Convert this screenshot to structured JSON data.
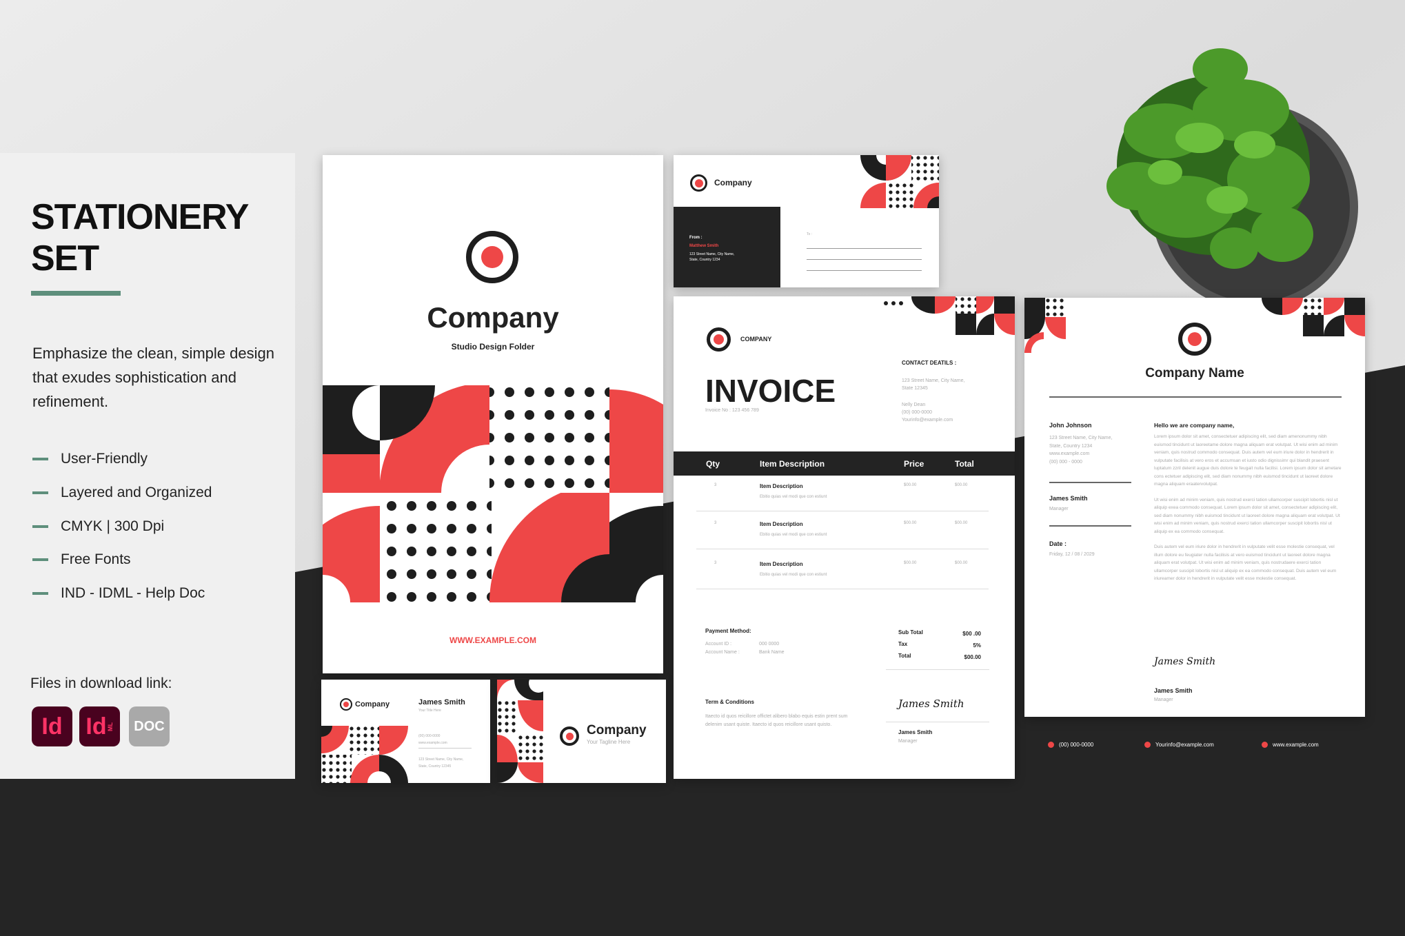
{
  "colors": {
    "accent_red": "#ee4747",
    "dark": "#232323",
    "green": "#5e8f7c",
    "panel": "#f0f0f0"
  },
  "left_panel": {
    "title_line1": "STATIONERY",
    "title_line2": "SET",
    "description": "Emphasize the clean, simple design that exudes sophistication and refinement.",
    "features": [
      "User-Friendly",
      "Layered and Organized",
      "CMYK | 300 Dpi",
      "Free Fonts",
      "IND - IDML - Help Doc"
    ],
    "files_label": "Files in download link:",
    "file_icons": [
      {
        "icon": "indesign-icon",
        "label": "Id"
      },
      {
        "icon": "idml-icon",
        "label": "Id",
        "sub": "ML"
      },
      {
        "icon": "doc-icon",
        "label": "DOC"
      }
    ]
  },
  "folder": {
    "company": "Company",
    "subtitle": "Studio Design Folder",
    "website": "WWW.EXAMPLE.COM"
  },
  "envelope": {
    "company": "Company",
    "from_label": "From :",
    "from_name": "Matthew Smith",
    "from_address1": "123 Street Name, City Name,",
    "from_address2": "State, Country 1234",
    "to_label": "To :"
  },
  "invoice": {
    "company": "COMPANY",
    "title": "INVOICE",
    "invoice_no": "Invoice No : 123 456 789",
    "contact_title": "CONTACT DEATILS :",
    "contact_address1": "123 Street Name, City Name,",
    "contact_address2": "State 12345",
    "contact_name": "Nelly Dean",
    "contact_phone": "(00) 000-0000",
    "contact_email": "Yourinfo@example.com",
    "columns": [
      "Qty",
      "Item Description",
      "Price",
      "Total"
    ],
    "rows": [
      {
        "qty": "3",
        "item": "Item Description",
        "desc": "Ebitio quias vel modi que con estiunt",
        "price": "$00.00",
        "total": "$00.00"
      },
      {
        "qty": "3",
        "item": "Item Description",
        "desc": "Ebitio quias vel modi que con estiunt",
        "price": "$00.00",
        "total": "$00.00"
      },
      {
        "qty": "3",
        "item": "Item Description",
        "desc": "Ebitio quias vel modi que con estiunt",
        "price": "$00.00",
        "total": "$00.00"
      }
    ],
    "payment_title": "Payment Method:",
    "account_id_label": "Account ID :",
    "account_id": "000 0000",
    "account_name_label": "Account Name :",
    "account_name": "Bank Name",
    "subtotal_label": "Sub Total",
    "subtotal": "$00 .00",
    "tax_label": "Tax",
    "tax": "5%",
    "total_label": "Total",
    "total": "$00.00",
    "terms_title": "Term & Conditions",
    "terms_text": "Itaecto id quos reicillore offictet alibero blabo equis estin prent sum delenim usant quiste. Itaecto id quos reicillore usant quisto.",
    "signature": "James Smith",
    "signer": "James Smith",
    "signer_role": "Manager"
  },
  "letter": {
    "company": "Company Name",
    "recipient": "John Johnson",
    "address1": "123 Street Name, City Name,",
    "address2": "State, Country 1234",
    "web": "www.example.com",
    "phone": "(00) 000 - 0000",
    "sender": "James Smith",
    "sender_role": "Manager",
    "date_label": "Date :",
    "date": "Friday, 12 / 08 / 2029",
    "greeting": "Hello we are company name,",
    "paragraphs": [
      "Lorem ipsum dolor sit amet, consectetuer adipiscing elit, sed diam amenonummy nibh euismod tincidunt ut laoreetame dolore magna aliquam erat volutpat. Ut wisi enim ad minim veniam, quis nostrud commodo consequat. Duis autem vel eum iriure dolor in hendrerit in vulputate facilisis at vero eros et accumsan et iusto odio dignissimr qui blandit praesent luptatum zzril delenit augue duis dolore te feugait nulla facilisi. Lorem ipsum dolor sit ametare cons ectetuer adipiscing elit, sed diam nonummy nibh euismod tincidunt ut laoreet dolore magna aliquam eraatervolutpat.",
      "Ut wisi enim ad minim veniam, quis nostrud exerci tation ullamcorper suscipit lobortis nisl ut aliquip exea commodo consequat. Lorem ipsum dolor sit amet, consectetuer adipiscing elit, sed diam nonummy nibh euismod tincidunt ut laoreet dolore magna aliquam erat volutpat. Ut wisi enim ad minim veniam, quis nostrud exerci tation ullamcorper suscipit lobortis nisl ut aliquip ex ea commodo consequat.",
      "Duis autem vel eum iriure dolor in hendrerit in vulputate velit esse molestie consequat, vel illum dolore eu feugiater nulla facilisis at vero euismod tincidunt ut laoreet dolore magna aliquam erat volutpat. Ut wisi enim ad minim veniam, quis nostrudaere exerci tation ullamcorper suscipit lobortis nisl ut aliquip ex ea commodo consequat. Duis autem vel eum iriureamer dolor in hendrerit in vulputate velit esse molestie consequat."
    ],
    "signature": "James Smith",
    "signer": "James Smith",
    "signer_role": "Manager",
    "footer": {
      "phone": "(00) 000-0000",
      "email": "Yourinfo@example.com",
      "web": "www.example.com"
    }
  },
  "business_card_front": {
    "company": "Company",
    "name": "James Smith",
    "title": "Your Title Here",
    "phone": "(00) 000-0000",
    "web": "www.example.com",
    "address1": "123 Street Name, City Name,",
    "address2": "State, Country 12345"
  },
  "business_card_back": {
    "company": "Company",
    "tagline": "Your Tagline Here"
  }
}
